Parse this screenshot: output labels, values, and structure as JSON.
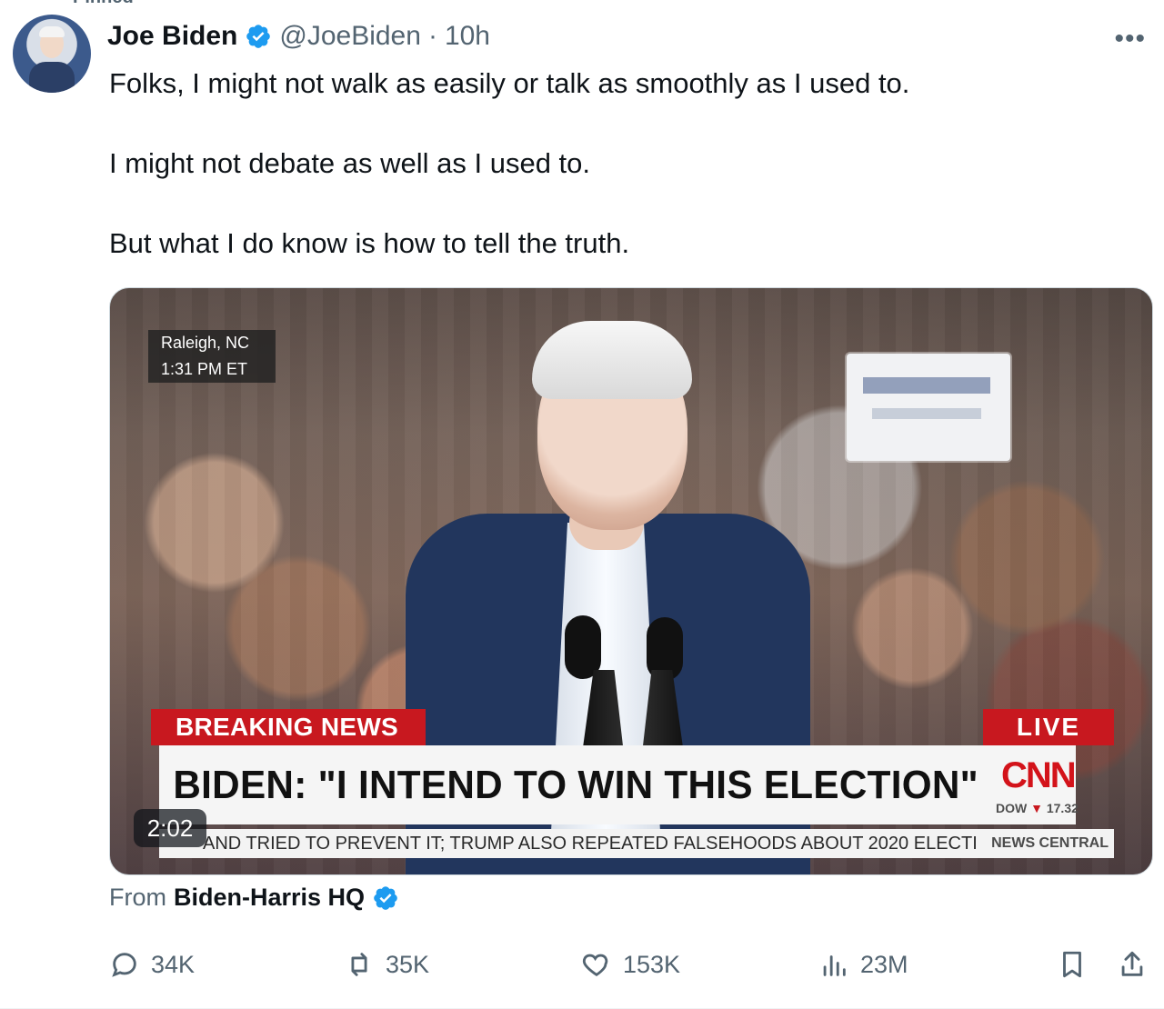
{
  "post": {
    "label": "Pinned",
    "author": {
      "name": "Joe Biden",
      "handle": "@JoeBiden",
      "timestamp": "10h"
    },
    "text": [
      "Folks, I might not walk as easily or talk as smoothly as I used to.",
      "I might not debate as well as I used to.",
      "But what I do know is how to tell the truth."
    ],
    "media": {
      "location": "Raleigh, NC",
      "time": "1:31 PM ET",
      "breaking": "BREAKING NEWS",
      "live": "LIVE",
      "headline": "BIDEN: \"I INTEND TO WIN THIS ELECTION\"",
      "network": "CNN",
      "dow_label": "DOW",
      "dow_arrow": "▼",
      "dow_value": "17.32",
      "ticker": "AND TRIED TO PREVENT IT; TRUMP ALSO REPEATED FALSEHOODS ABOUT 2020 ELECTI",
      "ticker_tag": "NEWS CENTRAL",
      "duration": "2:02"
    },
    "source": {
      "prefix": "From",
      "name": "Biden-Harris HQ"
    },
    "metrics": {
      "replies": "34K",
      "reposts": "35K",
      "likes": "153K",
      "views": "23M"
    }
  },
  "colors": {
    "verified": "#1d9bf0",
    "muted": "#536471",
    "cnn_red": "#c8181f"
  },
  "icons": [
    "verified-badge-icon",
    "more-icon",
    "reply-icon",
    "repost-icon",
    "like-icon",
    "views-icon",
    "bookmark-icon",
    "share-icon"
  ]
}
